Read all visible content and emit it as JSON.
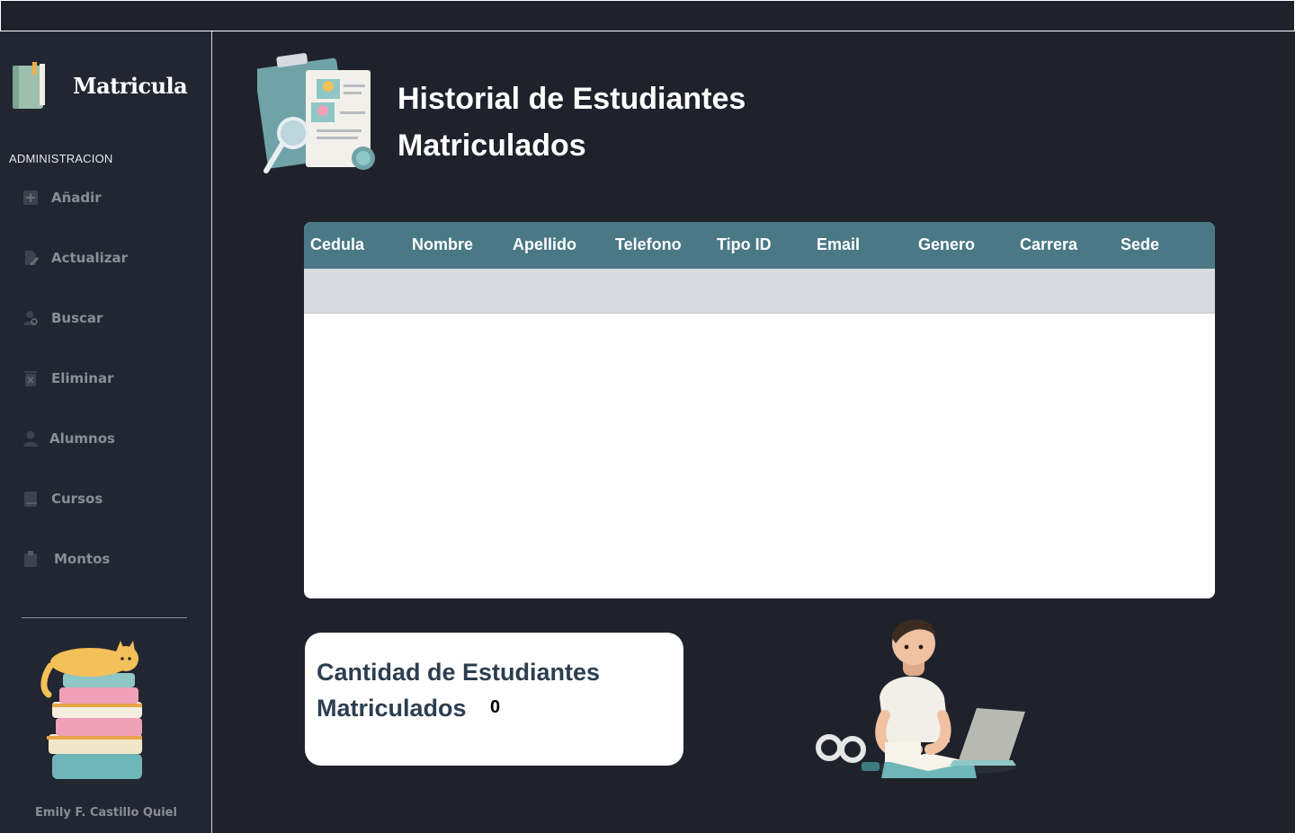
{
  "app": {
    "title": "Matricula"
  },
  "sidebar": {
    "section_label": "ADMINISTRACION",
    "items": [
      {
        "label": "Añadir",
        "icon": "plus-square-icon"
      },
      {
        "label": "Actualizar",
        "icon": "file-edit-icon"
      },
      {
        "label": "Buscar",
        "icon": "user-search-icon"
      },
      {
        "label": "Eliminar",
        "icon": "trash-icon"
      },
      {
        "label": "Alumnos",
        "icon": "user-icon"
      },
      {
        "label": "Cursos",
        "icon": "book-icon"
      },
      {
        "label": "Montos",
        "icon": "clipboard-icon"
      }
    ],
    "author": "Emily F. Castillo Quiel"
  },
  "main": {
    "title": "Historial de Estudiantes Matriculados",
    "table": {
      "columns": [
        "Cedula",
        "Nombre",
        "Apellido",
        "Telefono",
        "Tipo ID",
        "Email",
        "Genero",
        "Carrera",
        "Sede"
      ],
      "rows": []
    },
    "count": {
      "label": "Cantidad de Estudiantes Matriculados",
      "value": "0"
    }
  },
  "colors": {
    "background": "#1f222b",
    "sidebar": "#222630",
    "table_header": "#4a7885",
    "empty_row": "#d7dbe0",
    "count_label": "#2c3e50"
  }
}
